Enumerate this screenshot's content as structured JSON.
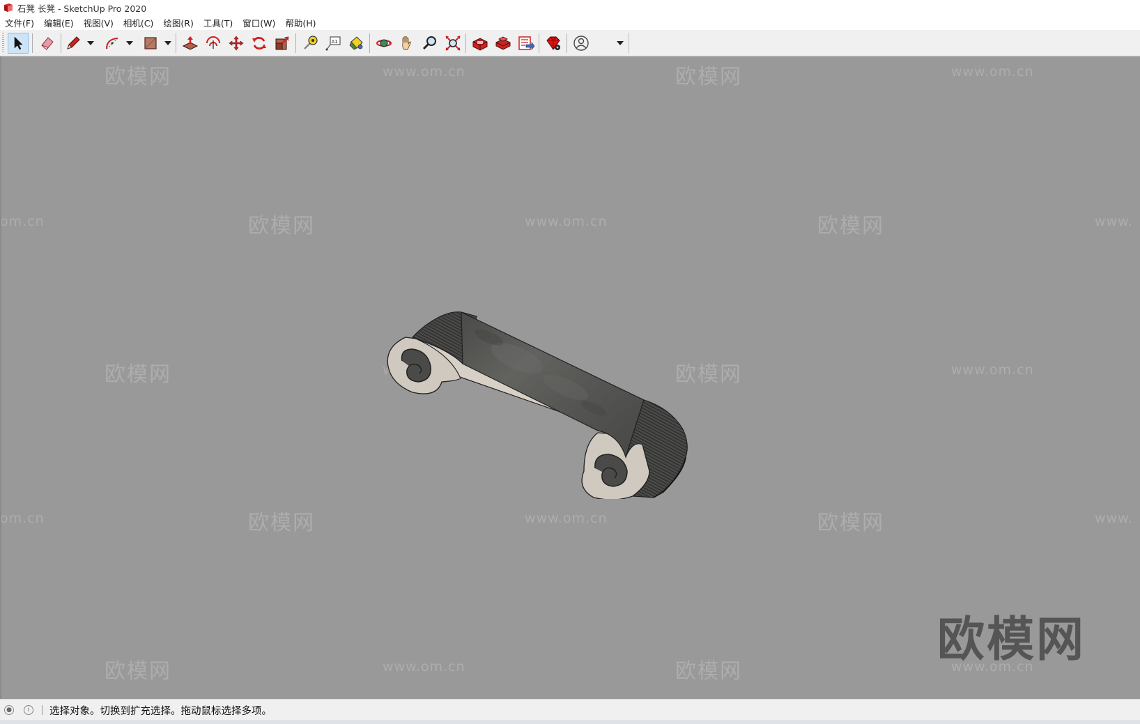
{
  "window": {
    "title": "石凳 长凳 - SketchUp Pro 2020"
  },
  "menu": [
    "文件(F)",
    "编辑(E)",
    "视图(V)",
    "相机(C)",
    "绘图(R)",
    "工具(T)",
    "窗口(W)",
    "帮助(H)"
  ],
  "toolbar": {
    "tools": [
      {
        "name": "select-tool",
        "icon": "arrow-cursor-icon",
        "active": true
      },
      {
        "name": "eraser-tool",
        "icon": "eraser-icon"
      },
      {
        "name": "line-tool",
        "icon": "pencil-icon",
        "dropdown": true
      },
      {
        "name": "arc-tool",
        "icon": "arc-icon",
        "dropdown": true
      },
      {
        "name": "rectangle-tool",
        "icon": "rectangle-icon",
        "dropdown": true
      },
      {
        "name": "push-pull-tool",
        "icon": "push-pull-icon"
      },
      {
        "name": "offset-tool",
        "icon": "offset-icon"
      },
      {
        "name": "move-tool",
        "icon": "move-icon"
      },
      {
        "name": "rotate-tool",
        "icon": "rotate-icon"
      },
      {
        "name": "scale-tool",
        "icon": "scale-icon"
      },
      {
        "name": "tape-measure-tool",
        "icon": "tape-measure-icon"
      },
      {
        "name": "text-tool",
        "icon": "text-icon"
      },
      {
        "name": "paint-bucket-tool",
        "icon": "paint-bucket-icon"
      },
      {
        "name": "orbit-tool",
        "icon": "orbit-icon"
      },
      {
        "name": "pan-tool",
        "icon": "hand-icon"
      },
      {
        "name": "zoom-tool",
        "icon": "magnifier-icon"
      },
      {
        "name": "zoom-extents-tool",
        "icon": "zoom-extents-icon"
      },
      {
        "name": "3d-warehouse-button",
        "icon": "warehouse-icon"
      },
      {
        "name": "extension-warehouse-button",
        "icon": "extension-warehouse-icon"
      },
      {
        "name": "send-to-layout-button",
        "icon": "layout-icon"
      },
      {
        "name": "extension-manager-button",
        "icon": "ruby-gem-icon"
      },
      {
        "name": "account-button",
        "icon": "user-account-icon",
        "dropdown": true
      }
    ],
    "text_tool_glyph": "A1"
  },
  "viewport": {
    "background": "#999999",
    "watermark_cn": "欧模网",
    "watermark_url": "www.om.cn",
    "watermark_url_partial_left": "om.cn",
    "watermark_url_partial_right": "www."
  },
  "status": {
    "message": "选择对象。切换到扩充选择。拖动鼠标选择多项。"
  },
  "colors": {
    "accent": "#cc1f1f",
    "active_tool": "#cce4f7",
    "stone_top": "#5a5a58",
    "stone_side": "#cfc9c0"
  }
}
